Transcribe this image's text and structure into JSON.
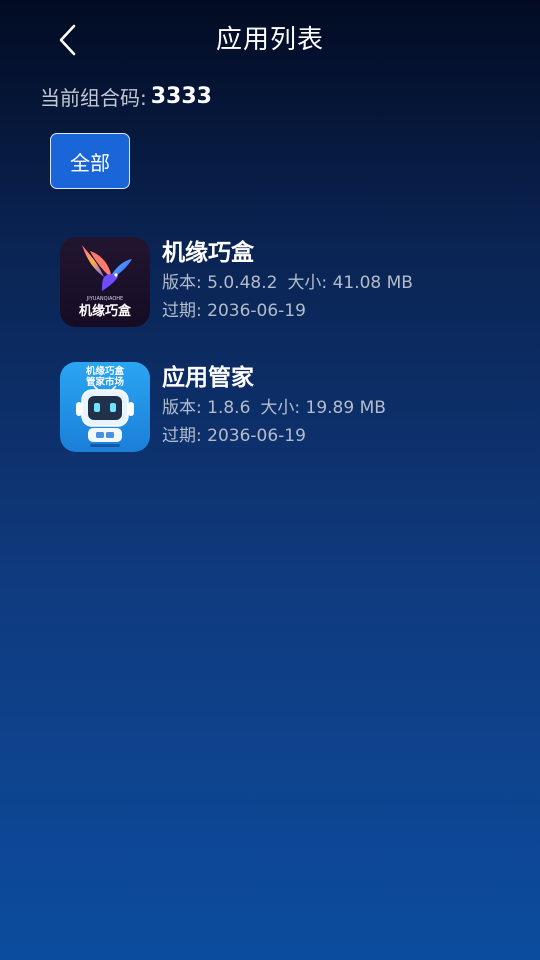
{
  "header": {
    "title": "应用列表"
  },
  "combo": {
    "label": "当前组合码:",
    "value": "3333"
  },
  "filter": {
    "label": "全部"
  },
  "apps": [
    {
      "name": "机缘巧盒",
      "version_label": "版本: 5.0.48.2",
      "size_label": "大小: 41.08 MB",
      "expire_label": "过期: 2036-06-19",
      "icon": "jiyuan-bird-logo-icon",
      "icon_text": "机缘巧盒",
      "icon_subtext": "JIYUANQIAOHE"
    },
    {
      "name": "应用管家",
      "version_label": "版本: 1.8.6",
      "size_label": "大小: 19.89 MB",
      "expire_label": "过期: 2036-06-19",
      "icon": "robot-tv-logo-icon",
      "icon_text_line1": "机缘巧盒",
      "icon_text_line2": "管家市场"
    }
  ],
  "colors": {
    "background_top": "#020b22",
    "background_bottom": "#0c4c9e",
    "button_fill": "#1a66d8",
    "meta_text": "#b3bcc9"
  }
}
